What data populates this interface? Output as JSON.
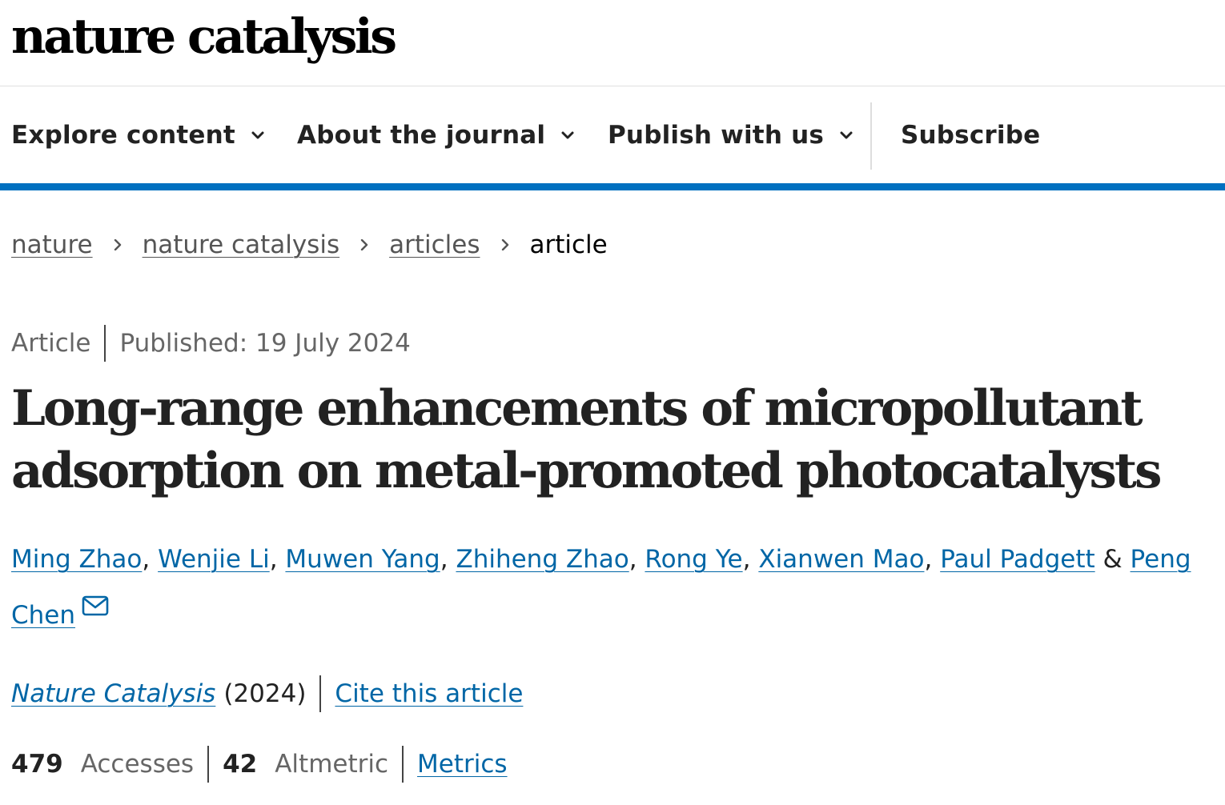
{
  "site": {
    "brand": "nature catalysis"
  },
  "nav": {
    "items": [
      {
        "label": "Explore content"
      },
      {
        "label": "About the journal"
      },
      {
        "label": "Publish with us"
      }
    ],
    "subscribe": "Subscribe"
  },
  "breadcrumb": {
    "links": [
      "nature",
      "nature catalysis",
      "articles"
    ],
    "current": "article"
  },
  "article": {
    "type": "Article",
    "published": "Published: 19 July 2024",
    "title": "Long-range enhancements of micropollutant adsorption on metal-promoted photocatalysts",
    "authors": [
      "Ming Zhao",
      "Wenjie Li",
      "Muwen Yang",
      "Zhiheng Zhao",
      "Rong Ye",
      "Xianwen Mao",
      "Paul Padgett",
      "Peng Chen"
    ],
    "separator": ", ",
    "last_separator": " & ",
    "journal": "Nature Catalysis",
    "year": "(2024)",
    "cite_label": "Cite this article"
  },
  "metrics": {
    "accesses_count": "479",
    "accesses_label": "Accesses",
    "altmetric_count": "42",
    "altmetric_label": "Altmetric",
    "metrics_link": "Metrics"
  },
  "icons": {
    "nav_chevron": "chevron-down-icon",
    "breadcrumb_separator": "chevron-right-icon",
    "corresponding_author": "mail-icon"
  },
  "colors": {
    "accent": "#0070c0",
    "link": "#0066a6",
    "text": "#222222",
    "muted": "#666666"
  }
}
